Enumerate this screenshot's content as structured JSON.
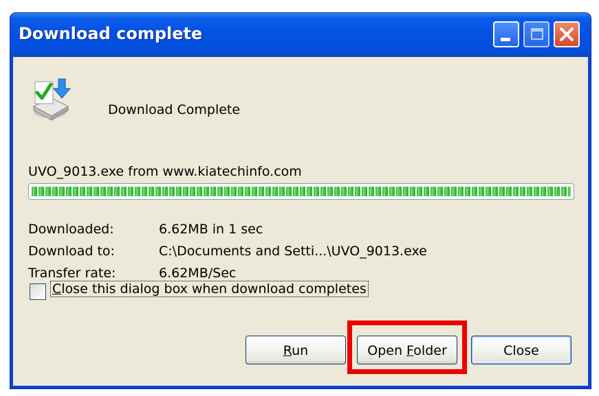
{
  "window": {
    "title": "Download complete",
    "buttons": {
      "minimize": "minimize-icon",
      "maximize": "maximize-icon",
      "close": "close-icon"
    }
  },
  "dialog": {
    "icon": "download-complete-icon",
    "status": "Download Complete",
    "source": "UVO_9013.exe from www.kiatechinfo.com",
    "progress_percent": 100,
    "progress_color": "#2fba2f",
    "rows": [
      {
        "label": "Downloaded:",
        "value": "6.62MB in 1 sec"
      },
      {
        "label": "Download to:",
        "value": "C:\\Documents and Setti...\\UVO_9013.exe"
      },
      {
        "label": "Transfer rate:",
        "value": "6.62MB/Sec"
      }
    ],
    "close_when_complete": {
      "label": "Close this dialog box when download completes",
      "checked": false
    }
  },
  "buttons": {
    "run": {
      "label": "Run",
      "accel": "R"
    },
    "open_folder": {
      "label": "Open Folder",
      "accel": "F"
    },
    "close": {
      "label": "Close"
    }
  },
  "annotation": {
    "highlight_color": "#ee0000"
  }
}
